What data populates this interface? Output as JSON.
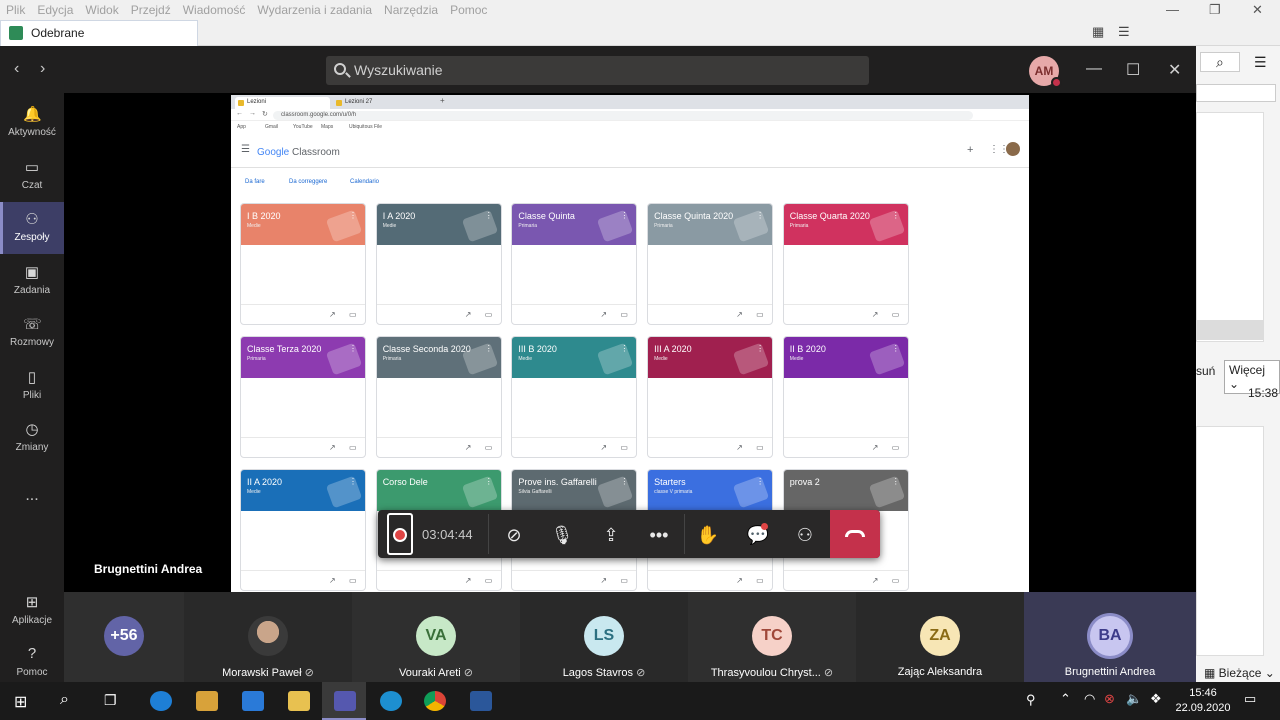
{
  "mail_app": {
    "menu": [
      "Plik",
      "Edycja",
      "Widok",
      "Przejdź",
      "Wiadomość",
      "Wydarzenia i zadania",
      "Narzędzia",
      "Pomoc"
    ],
    "tab_title": "Odebrane",
    "right_panel": {
      "button_delete_partial": "suń",
      "button_more": "Więcej",
      "time": "15:38",
      "status_label": "Bieżące"
    }
  },
  "teams": {
    "search_placeholder": "Wyszukiwanie",
    "user_initials": "AM",
    "rail": [
      {
        "label": "Aktywność",
        "icon": "bell-icon"
      },
      {
        "label": "Czat",
        "icon": "chat-icon"
      },
      {
        "label": "Zespoły",
        "icon": "teams-icon",
        "active": true
      },
      {
        "label": "Zadania",
        "icon": "assignments-icon"
      },
      {
        "label": "Rozmowy",
        "icon": "phone-icon"
      },
      {
        "label": "Pliki",
        "icon": "file-icon"
      },
      {
        "label": "Zmiany",
        "icon": "clock-icon"
      },
      {
        "label": "...",
        "icon": "more-icon"
      }
    ],
    "rail_bottom": [
      {
        "label": "Aplikacje",
        "icon": "apps-icon"
      },
      {
        "label": "Pomoc",
        "icon": "help-icon"
      }
    ],
    "presenter_name": "Brugnettini Andrea",
    "call_timer": "03:04:44",
    "participants": [
      {
        "initials": "+56",
        "name": "",
        "color": "#6264a7",
        "text_color": "#ffffff"
      },
      {
        "initials": "",
        "name": "Morawski Paweł",
        "photo": true
      },
      {
        "initials": "VA",
        "name": "Vouraki Areti",
        "color": "#c7e8c7",
        "text_color": "#3a6f3a"
      },
      {
        "initials": "LS",
        "name": "Lagos Stavros",
        "color": "#c9e8ef",
        "text_color": "#2b6f80"
      },
      {
        "initials": "TC",
        "name": "Thrasyvoulou Chryst...",
        "color": "#f6d1c8",
        "text_color": "#a0483a"
      },
      {
        "initials": "ZA",
        "name": "Zając Aleksandra",
        "color": "#f7e6b5",
        "text_color": "#8a6a14"
      },
      {
        "initials": "BA",
        "name": "Brugnettini Andrea",
        "color": "#c8c6f0",
        "text_color": "#3d3b8a"
      }
    ]
  },
  "shared_screen": {
    "browser_tabs": [
      "Lezioni",
      "Lezioni 27"
    ],
    "url": "classroom.google.com/u/0/h",
    "bookmarks": [
      "App",
      "Gmail",
      "YouTube",
      "Maps",
      "Ubiquitous File"
    ],
    "app_title_brand": "Google",
    "app_title_rest": " Classroom",
    "subnav": [
      "Da fare",
      "Da correggere",
      "Calendario"
    ],
    "cards": [
      {
        "name": "I B 2020",
        "sub": "Medie",
        "color": "#e8836a"
      },
      {
        "name": "I A 2020",
        "sub": "Medie",
        "color": "#546b76"
      },
      {
        "name": "Classe Quinta",
        "sub": "Primaria",
        "color": "#7a57b0"
      },
      {
        "name": "Classe Quinta 2020",
        "sub": "Primaria",
        "color": "#8a9aa3"
      },
      {
        "name": "Classe Quarta 2020",
        "sub": "Primaria",
        "color": "#d0325f"
      },
      {
        "name": "Classe Terza 2020",
        "sub": "Primaria",
        "color": "#8d3bb0"
      },
      {
        "name": "Classe Seconda 2020",
        "sub": "Primaria",
        "color": "#5f7079"
      },
      {
        "name": "III B 2020",
        "sub": "Medie",
        "color": "#2e8a8e"
      },
      {
        "name": "III A 2020",
        "sub": "Medie",
        "color": "#a0204f"
      },
      {
        "name": "II B 2020",
        "sub": "Medie",
        "color": "#7b2aa8"
      },
      {
        "name": "II A 2020",
        "sub": "Medie",
        "color": "#1a6fb8"
      },
      {
        "name": "Corso Dele",
        "sub": "",
        "color": "#3c9a6e"
      },
      {
        "name": "Prove ins. Gaffarelli",
        "sub": "Silvia Gaffarelli",
        "color": "#5d6a70"
      },
      {
        "name": "Starters",
        "sub": "classe V primaria",
        "color": "#3b6fe0"
      },
      {
        "name": "prova 2",
        "sub": "",
        "color": "#666666"
      }
    ]
  },
  "taskbar": {
    "time": "15:46",
    "date": "22.09.2020"
  },
  "colors": {
    "accent": "#6264a7",
    "hangup": "#c4314b",
    "record": "#e04545"
  }
}
